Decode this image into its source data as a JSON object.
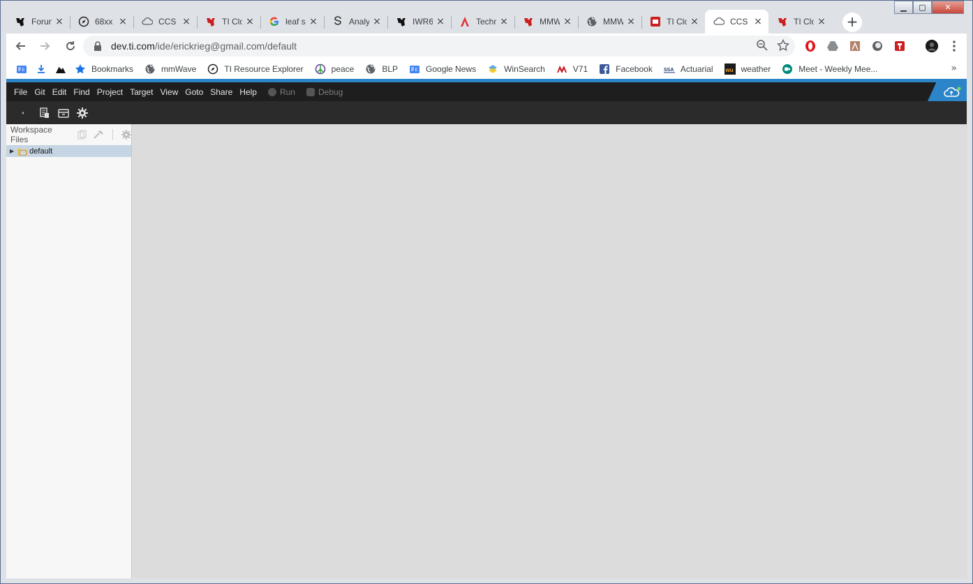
{
  "browser": {
    "tabs": [
      {
        "label": "Forun",
        "icon": "ti-logo-icon",
        "active": false
      },
      {
        "label": "68xx",
        "icon": "compass-icon",
        "active": false
      },
      {
        "label": "CCS C",
        "icon": "cloud-icon",
        "active": false
      },
      {
        "label": "TI Clo",
        "icon": "ti-red-logo-icon",
        "active": false
      },
      {
        "label": "leaf s",
        "icon": "google-icon",
        "active": false
      },
      {
        "label": "Analy",
        "icon": "s-logo-icon",
        "active": false
      },
      {
        "label": "IWR6",
        "icon": "ti-logo-icon",
        "active": false
      },
      {
        "label": "Techn",
        "icon": "a-logo-icon",
        "active": false
      },
      {
        "label": "MMW",
        "icon": "ti-red-logo-icon",
        "active": false
      },
      {
        "label": "MMW",
        "icon": "globe-icon",
        "active": false
      },
      {
        "label": "TI Clo",
        "icon": "ti-cloud-red-icon",
        "active": false
      },
      {
        "label": "CCS",
        "icon": "cloud-icon",
        "active": true
      },
      {
        "label": "TI Clo",
        "icon": "ti-red-logo-icon",
        "active": false
      }
    ],
    "new_tab": "+",
    "url_host": "dev.ti.com",
    "url_path": "/ide/erickrieg@gmail.com/default",
    "bookmarks": [
      {
        "label": "",
        "icon": "google-news-icon"
      },
      {
        "label": "",
        "icon": "download-icon"
      },
      {
        "label": "",
        "icon": "mountain-icon"
      },
      {
        "label": "Bookmarks",
        "icon": "star-icon"
      },
      {
        "label": "mmWave",
        "icon": "globe-icon"
      },
      {
        "label": "TI Resource Explorer",
        "icon": "compass-icon"
      },
      {
        "label": "peace",
        "icon": "peace-icon"
      },
      {
        "label": "BLP",
        "icon": "globe-icon"
      },
      {
        "label": "Google News",
        "icon": "google-news-icon"
      },
      {
        "label": "WinSearch",
        "icon": "winsearch-icon"
      },
      {
        "label": "V71",
        "icon": "microchip-icon"
      },
      {
        "label": "Facebook",
        "icon": "facebook-icon"
      },
      {
        "label": "Actuarial",
        "icon": "ssa-icon"
      },
      {
        "label": "weather",
        "icon": "wu-icon"
      },
      {
        "label": "Meet - Weekly Mee...",
        "icon": "meet-icon"
      }
    ],
    "bookmarks_more": "»"
  },
  "ide": {
    "menu": [
      "File",
      "Git",
      "Edit",
      "Find",
      "Project",
      "Target",
      "View",
      "Goto",
      "Share",
      "Help"
    ],
    "run_label": "Run",
    "debug_label": "Debug",
    "sidebar_title": "Workspace Files",
    "tree": [
      {
        "label": "default"
      }
    ]
  },
  "colors": {
    "accent": "#2b85c8",
    "menubar": "#1e1e1e",
    "subbar": "#2b2b2b",
    "selection": "#c5d5e4"
  }
}
